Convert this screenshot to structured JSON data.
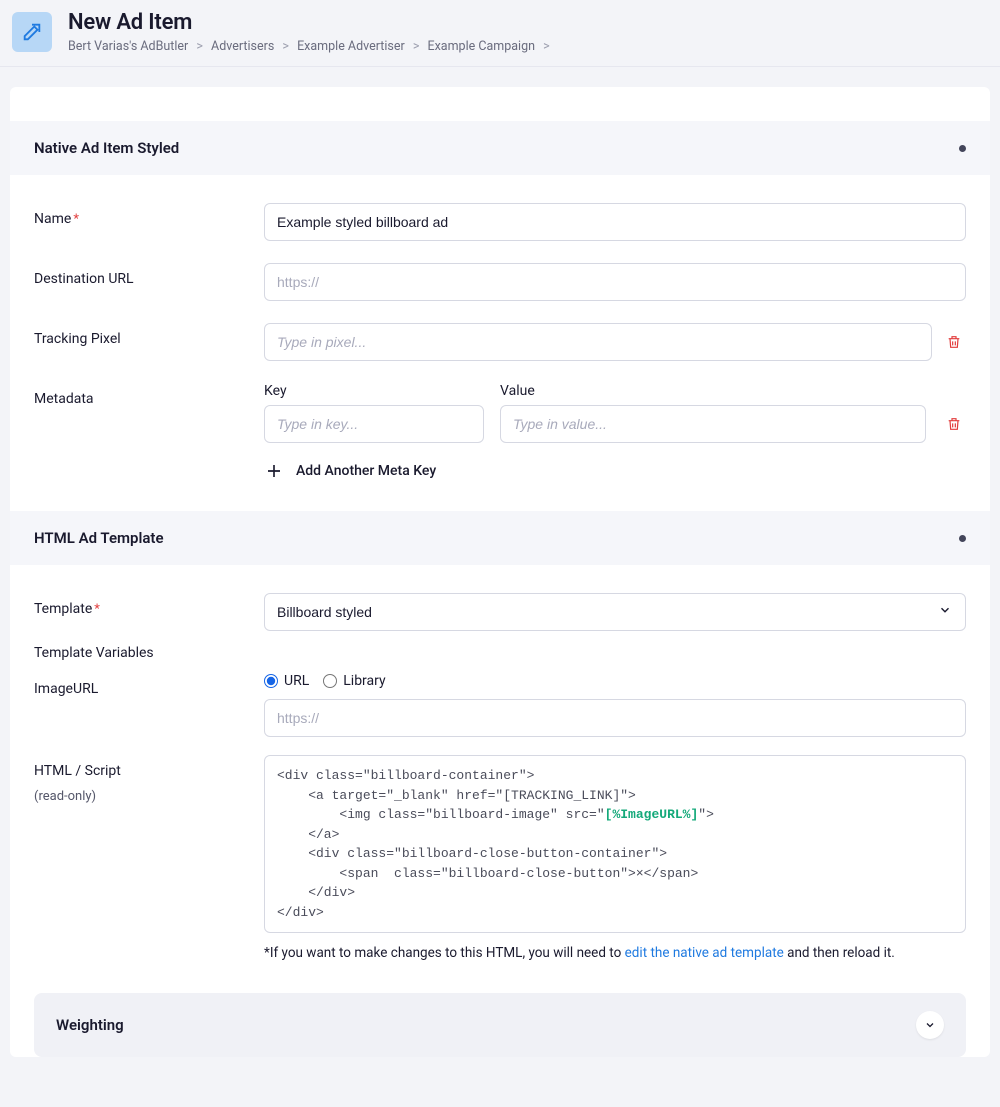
{
  "header": {
    "title": "New Ad Item",
    "breadcrumb": [
      "Bert Varias's AdButler",
      "Advertisers",
      "Example Advertiser",
      "Example Campaign"
    ]
  },
  "section_native": {
    "title": "Native Ad Item Styled",
    "name_label": "Name",
    "name_value": "Example styled billboard ad",
    "dest_label": "Destination URL",
    "dest_placeholder": "https://",
    "tracking_label": "Tracking Pixel",
    "tracking_placeholder": "Type in pixel...",
    "meta_label": "Metadata",
    "meta_key_label": "Key",
    "meta_value_label": "Value",
    "meta_key_placeholder": "Type in key...",
    "meta_value_placeholder": "Type in value...",
    "add_meta_label": "Add Another Meta Key"
  },
  "section_template": {
    "title": "HTML Ad Template",
    "template_label": "Template",
    "template_value": "Billboard styled",
    "vars_label": "Template Variables",
    "imageurl_label": "ImageURL",
    "radio_url": "URL",
    "radio_library": "Library",
    "imageurl_placeholder": "https://",
    "html_label": "HTML / Script",
    "html_sub": "(read-only)",
    "code_pre": "<div class=\"billboard-container\">\n    <a target=\"_blank\" href=\"[TRACKING_LINK]\">\n        <img class=\"billboard-image\" src=\"",
    "code_hl": "[%ImageURL%]",
    "code_post": "\">\n    </a>\n    <div class=\"billboard-close-button-container\">\n        <span  class=\"billboard-close-button\">×</span>\n    </div>\n</div>",
    "footnote_pre": "*If you want to make changes to this HTML, you will need to ",
    "footnote_link": "edit the native ad template",
    "footnote_post": " and then reload it."
  },
  "section_weighting": {
    "title": "Weighting"
  }
}
